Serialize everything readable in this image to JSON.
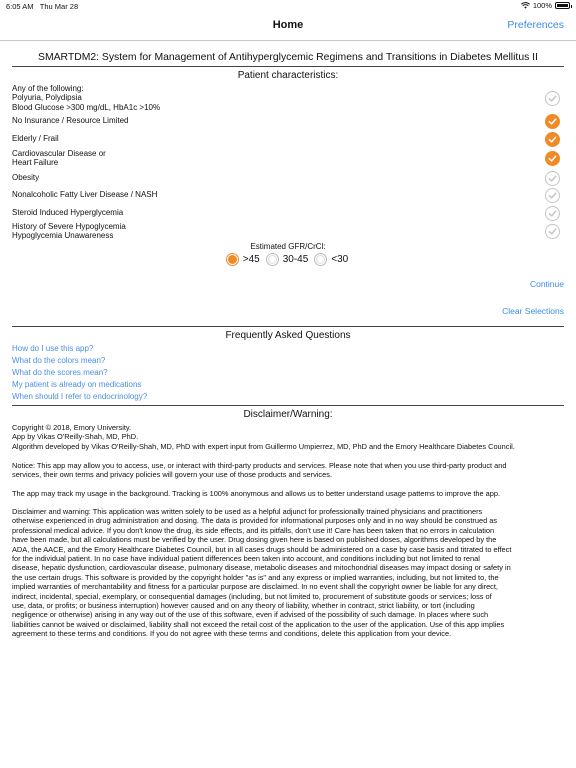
{
  "status": {
    "time": "6:05 AM",
    "date": "Thu Mar 28",
    "battery": "100%",
    "battery_level": 1.0
  },
  "nav": {
    "title": "Home",
    "preferences": "Preferences"
  },
  "app_title": "SMARTDM2: System for Management of Antihyperglycemic Regimens and Transitions in Diabetes Mellitus II",
  "patient": {
    "title": "Patient characteristics:",
    "items": [
      {
        "label": "Any of the following:\nPolyuria, Polydipsia\nBlood Glucose >300 mg/dL, HbA1c >10%",
        "checked": false
      },
      {
        "label": "No Insurance / Resource Limited",
        "checked": true
      },
      {
        "label": "Elderly / Frail",
        "checked": true
      },
      {
        "label": "Cardiovascular Disease or\nHeart Failure",
        "checked": true
      },
      {
        "label": "Obesity",
        "checked": false
      },
      {
        "label": "Nonalcoholic Fatty Liver Disease / NASH",
        "checked": false
      },
      {
        "label": "Steroid Induced Hyperglycemia",
        "checked": false
      },
      {
        "label": "History of Severe Hypoglycemia\nHypoglycemia Unawareness",
        "checked": false
      }
    ]
  },
  "gfr": {
    "label": "Estimated GFR/CrCl:",
    "options": [
      {
        "label": ">45",
        "selected": true
      },
      {
        "label": "30-45",
        "selected": false
      },
      {
        "label": "<30",
        "selected": false
      }
    ]
  },
  "actions": {
    "continue": "Continue",
    "clear": "Clear Selections"
  },
  "faq": {
    "title": "Frequently Asked Questions",
    "items": [
      "How do I use this app?",
      "What do the colors mean?",
      "What do the scores mean?",
      "My patient is already on medications",
      "When should I refer to endocrinology?"
    ]
  },
  "disclaimer": {
    "title": "Disclaimer/Warning:",
    "copyright": [
      "Copyright © 2018, Emory University.",
      "App by Vikas O'Reilly-Shah, MD, PhD.",
      "Algorithm developed by Vikas O'Reilly-Shah, MD, PhD with expert input from Guillermo Umpierrez, MD, PhD and the Emory Healthcare Diabetes Council."
    ],
    "notice": [
      "Notice: This app may allow you to access, use, or interact with third-party products and services. Please note that when you use third-party product and",
      "services, their own terms and privacy policies will govern your use of those products and services."
    ],
    "tracking": [
      "The app may track my usage in the background. Tracking is 100% anonymous and allows us to better understand usage patterns to improve the app."
    ],
    "warning": [
      "Disclaimer and warning: This application was written solely to be used as a helpful adjunct for professionally trained physicians and practitioners",
      "otherwise experienced in drug administration and dosing. The data is provided for informational purposes only and in no way should be construed as",
      "professional medical advice. If you don't know the drug, its side effects, and its pitfalls, don't use it! Care has been taken that no errors in calculation",
      "have been made, but all calculations must be verified by the user. Drug dosing given here is based on published doses, algorithms developed by the",
      "ADA, the AACE, and the Emory Healthcare Diabetes Council, but in all cases drugs should be administered on a case by case basis and titrated to effect",
      "for the individual patient. In no case have individual patient differences been taken into account, and conditions including but not limited to renal",
      "disease, hepatic dysfunction, cardiovascular disease, pulmonary disease, metabolic diseases and mitochondrial diseases may impact dosing or safety in",
      "the use certain drugs. This software is provided by the copyright holder \"as is\" and any express or implied warranties, including, but not limited to, the",
      "implied warranties of merchantability and fitness for a particular purpose are disclaimed. In no event shall the copyright owner be liable for any direct,",
      "indirect, incidental, special, exemplary, or consequential damages (including, but not limited to, procurement of substitute goods or services; loss of",
      "use, data, or profits; or business interruption) however caused and on any theory of liability, whether in contract, strict liability, or tort (including",
      "negligence or otherwise) arising in any way out of the use of this software, even if advised of the possibility of such damage. In places where such",
      "liabilities cannot be waived or disclaimed, liability shall not exceed the retail cost of the application to the user of the application. Use of this app implies",
      "agreement to these terms and conditions. If you do not agree with these terms and conditions, delete this application from your device."
    ]
  }
}
